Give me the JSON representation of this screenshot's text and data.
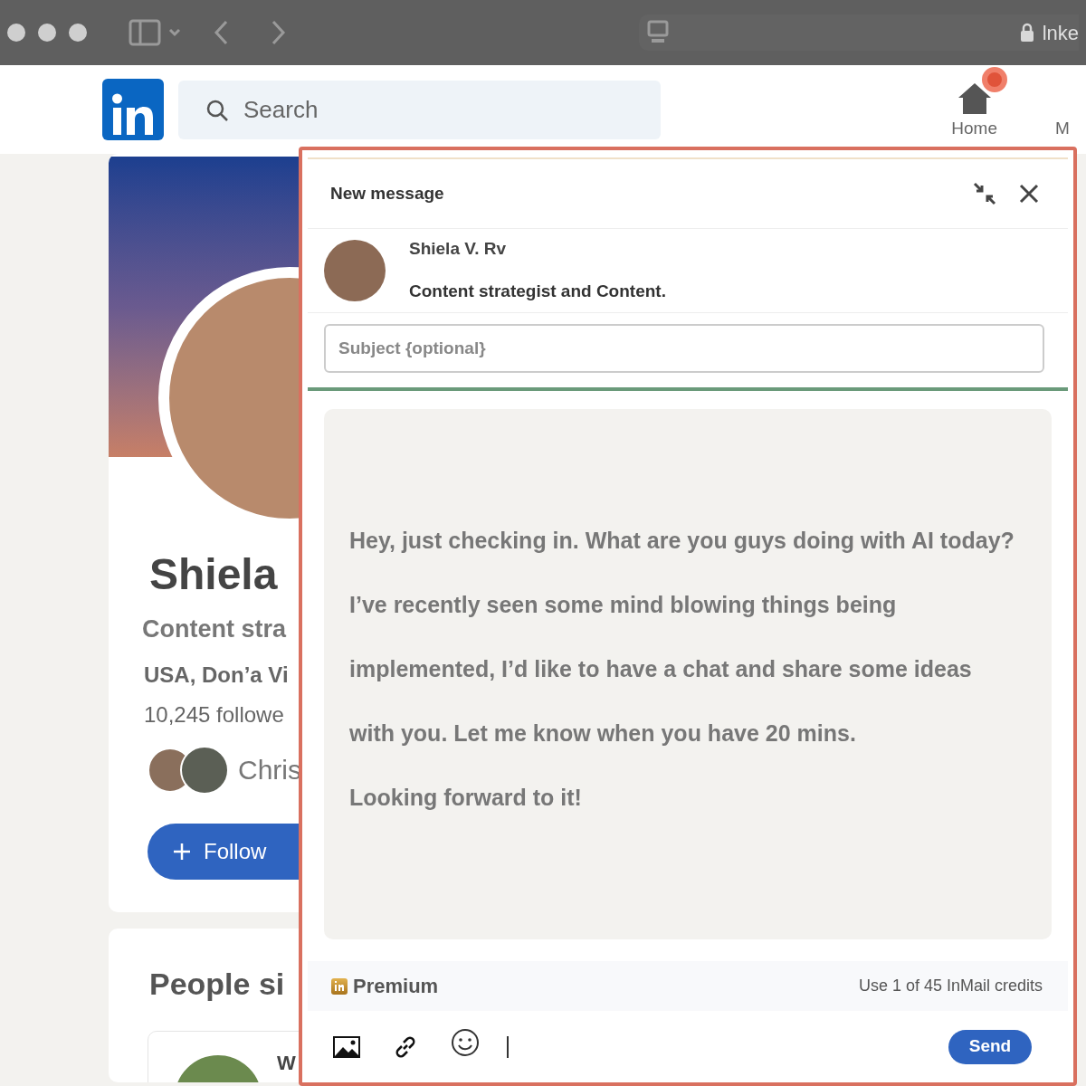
{
  "browser": {
    "address": "lnke"
  },
  "header": {
    "search": {
      "placeholder": "Search"
    },
    "nav": [
      {
        "label": "Home",
        "notification": true
      },
      {
        "label": "M"
      }
    ]
  },
  "profile": {
    "name": "Shiela",
    "headline": "Content stra",
    "location": "USA, Don’a Vi",
    "followers": "10,245 followe",
    "mutual": "Chris",
    "follow_button": "Follow"
  },
  "people_similar": {
    "title": "People si",
    "first_name": "W"
  },
  "message_dialog": {
    "title": "New message",
    "recipient": {
      "name": "Shiela V. Rv",
      "headline": "Content strategist and Content."
    },
    "subject": {
      "placeholder": "Subject {optional}"
    },
    "body": [
      "Hey, just checking in. What are you guys doing with AI today? I’ve recently seen some mind blowing things being implemented, I’d like to have a chat and share some ideas with you. Let me know when you have 20 mins.",
      "Looking forward to it!"
    ],
    "premium": "Premium",
    "credits": "Use 1 of 45 InMail credits",
    "send_button": "Send"
  }
}
